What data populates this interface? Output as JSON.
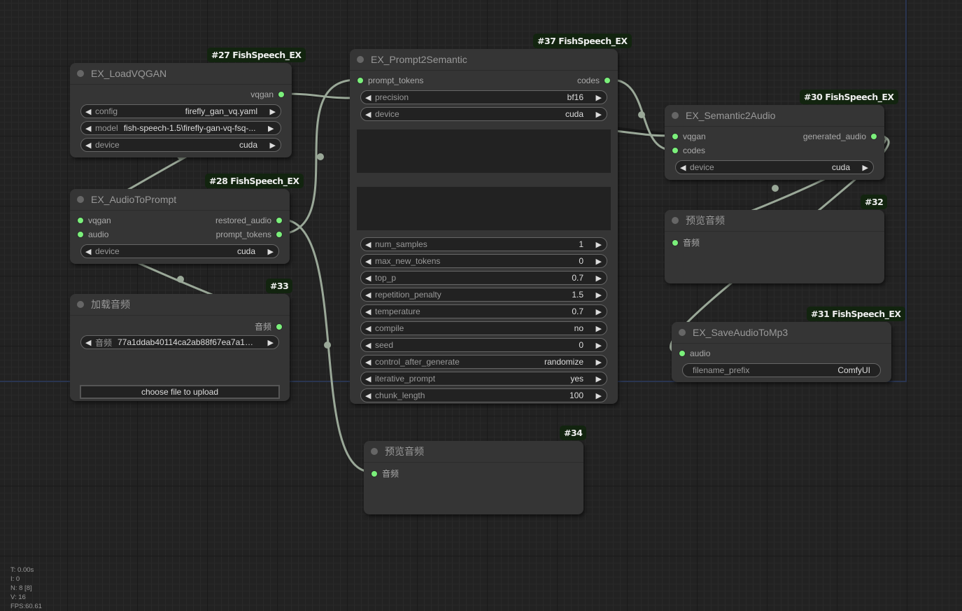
{
  "canvas": {
    "link_color": "#9aa898",
    "slot_color": "#7bf07b",
    "badge_bg": "#12240f"
  },
  "nodes": {
    "load_vqgan": {
      "badge": "#27 FishSpeech_EX",
      "title": "EX_LoadVQGAN",
      "outputs": [
        "vqgan"
      ],
      "widgets": [
        {
          "label": "config",
          "value": "firefly_gan_vq.yaml"
        },
        {
          "label": "model",
          "value": "fish-speech-1.5\\firefly-gan-vq-fsq-..."
        },
        {
          "label": "device",
          "value": "cuda"
        }
      ]
    },
    "audio_to_prompt": {
      "badge": "#28 FishSpeech_EX",
      "title": "EX_AudioToPrompt",
      "inputs": [
        "vqgan",
        "audio"
      ],
      "outputs": [
        "restored_audio",
        "prompt_tokens"
      ],
      "widgets": [
        {
          "label": "device",
          "value": "cuda"
        }
      ]
    },
    "load_audio": {
      "badge": "#33",
      "title": "加载音频",
      "outputs": [
        "音频"
      ],
      "widgets": [
        {
          "label": "音频",
          "value": "77a1ddab40114ca2ab88f67ea7a1c..."
        }
      ],
      "upload_label": "choose file to upload"
    },
    "prompt2semantic": {
      "badge": "#37 FishSpeech_EX",
      "title": "EX_Prompt2Semantic",
      "inputs": [
        "prompt_tokens"
      ],
      "outputs": [
        "codes"
      ],
      "widgets_top": [
        {
          "label": "precision",
          "value": "bf16"
        },
        {
          "label": "device",
          "value": "cuda"
        }
      ],
      "text_inputs": [
        "",
        ""
      ],
      "widgets": [
        {
          "label": "num_samples",
          "value": "1"
        },
        {
          "label": "max_new_tokens",
          "value": "0"
        },
        {
          "label": "top_p",
          "value": "0.7"
        },
        {
          "label": "repetition_penalty",
          "value": "1.5"
        },
        {
          "label": "temperature",
          "value": "0.7"
        },
        {
          "label": "compile",
          "value": "no"
        },
        {
          "label": "seed",
          "value": "0"
        },
        {
          "label": "control_after_generate",
          "value": "randomize"
        },
        {
          "label": "iterative_prompt",
          "value": "yes"
        },
        {
          "label": "chunk_length",
          "value": "100"
        }
      ]
    },
    "semantic2audio": {
      "badge": "#30 FishSpeech_EX",
      "title": "EX_Semantic2Audio",
      "inputs": [
        "vqgan",
        "codes"
      ],
      "outputs": [
        "generated_audio"
      ],
      "widgets": [
        {
          "label": "device",
          "value": "cuda"
        }
      ]
    },
    "preview_audio_32": {
      "badge": "#32",
      "title": "预览音频",
      "inputs": [
        "音频"
      ]
    },
    "save_audio_mp3": {
      "badge": "#31 FishSpeech_EX",
      "title": "EX_SaveAudioToMp3",
      "inputs": [
        "audio"
      ],
      "widgets": [
        {
          "label": "filename_prefix",
          "value": "ComfyUI"
        }
      ]
    },
    "preview_audio_34": {
      "badge": "#34",
      "title": "预览音频",
      "inputs": [
        "音频"
      ]
    }
  },
  "stats": {
    "time": "T: 0.00s",
    "iterations": "I: 0",
    "nodes": "N: 8 [8]",
    "vertices": "V: 16",
    "fps": "FPS:60.61"
  }
}
